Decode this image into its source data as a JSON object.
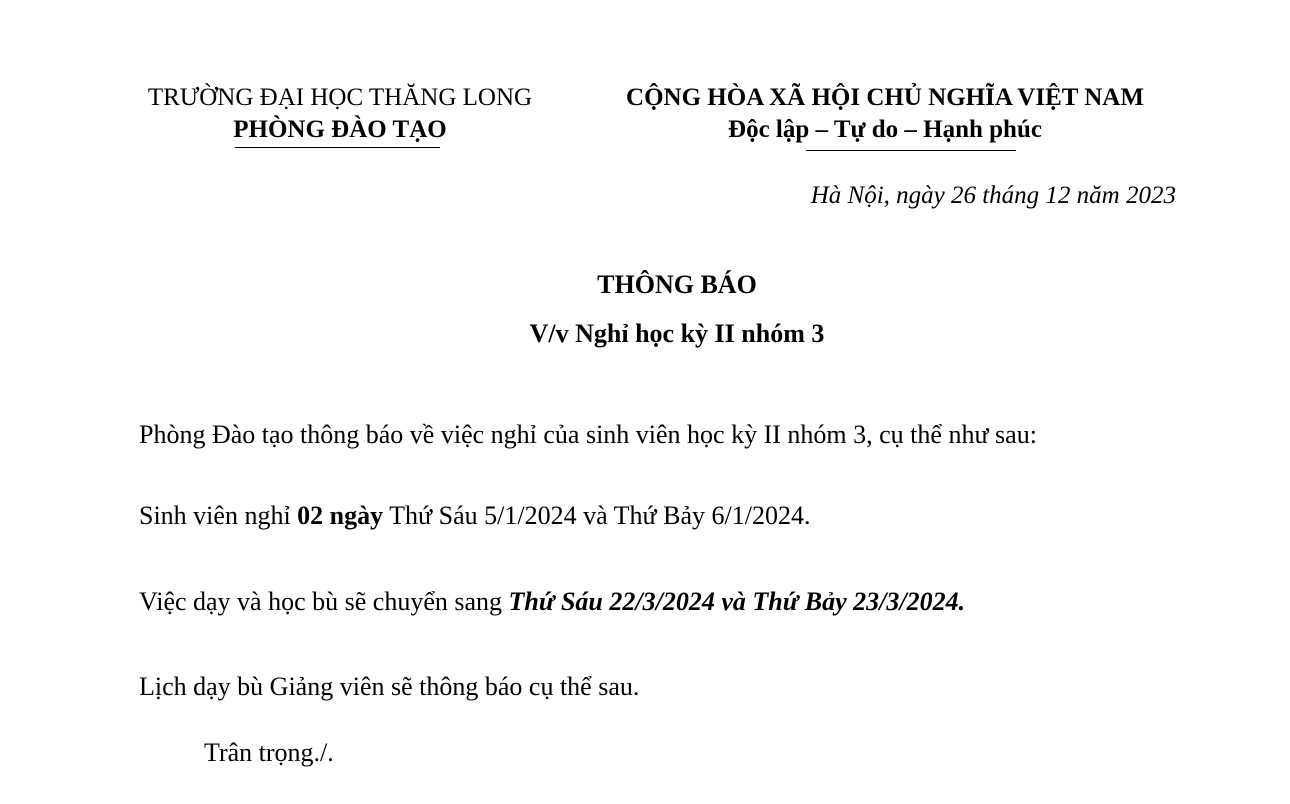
{
  "header": {
    "school": "TRƯỜNG ĐẠI HỌC THĂNG LONG",
    "department": "PHÒNG ĐÀO TẠO",
    "nation": "CỘNG HÒA XÃ HỘI CHỦ NGHĨA VIỆT NAM",
    "motto": "Độc lập – Tự do – Hạnh phúc"
  },
  "date_line": "Hà Nội, ngày 26 tháng 12 năm 2023",
  "notice": {
    "title": "THÔNG BÁO",
    "subject": "V/v Nghỉ học kỳ II nhóm 3"
  },
  "body": {
    "p1": "Phòng Đào tạo thông báo về việc nghỉ của sinh viên học kỳ II nhóm 3, cụ thể như sau:",
    "p2_pre": "Sinh viên nghỉ ",
    "p2_bold": "02 ngày",
    "p2_post": " Thứ Sáu 5/1/2024 và Thứ Bảy 6/1/2024.",
    "p3_pre": "Việc dạy và học bù sẽ chuyển sang ",
    "p3_emph": "Thứ Sáu 22/3/2024 và Thứ Bảy 23/3/2024.",
    "p4": "Lịch dạy bù Giảng viên sẽ thông báo cụ thể sau.",
    "closing": "Trân trọng./."
  }
}
